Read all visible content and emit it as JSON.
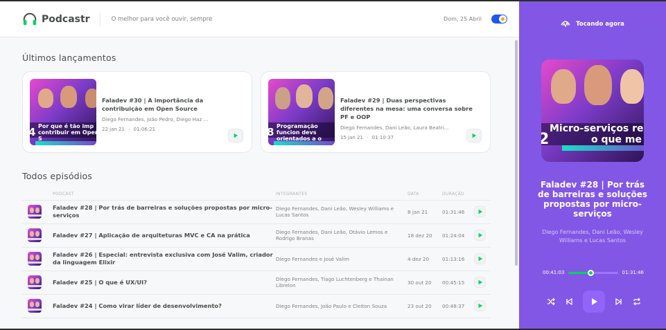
{
  "header": {
    "app_name": "Podcastr",
    "tagline": "O melhor para você ouvir, sempre",
    "date": "Dom, 25 Abril"
  },
  "latest": {
    "title": "Últimos lançamentos",
    "episodes": [
      {
        "title": "Faladev #30 | A importância da contribuição em Open Source",
        "members": "Diego Fernandes, João Pedro, Diego Haz ...",
        "date": "22 jan 21",
        "duration": "01:06:21",
        "thumb_text": "Por que é tão imp contribuir em Open S",
        "thumb_num": "4"
      },
      {
        "title": "Faladev #29 | Duas perspectivas diferentes na mesa: uma conversa sobre PF e OOP",
        "members": "Diego Fernandes, Dani Leão, Laura Beatri...",
        "date": "15 jan 21",
        "duration": "01:10:37",
        "thumb_text": "Programação funcion devs orientados a o",
        "thumb_num": "8"
      }
    ]
  },
  "all": {
    "title": "Todos episódios",
    "columns": [
      "PODCAST",
      "INTEGRANTES",
      "DATA",
      "DURAÇÃO"
    ],
    "rows": [
      {
        "title": "Faladev #28 | Por trás de barreiras e soluções propostas por micro-serviços",
        "members": "Diego Fernandes, Dani Leão, Wesley Williams e Lucas Santos",
        "date": "8 jan 21",
        "duration": "01:31:46"
      },
      {
        "title": "Faladev #27 | Aplicação de arquiteturas MVC e CA na prática",
        "members": "Diego Fernandes, Dani Leão, Otávio Lemos e Rodrigo Branas",
        "date": "18 dez 20",
        "duration": "01:24:04"
      },
      {
        "title": "Faladev #26 | Especial: entrevista exclusiva com José Valim, criador da linguagem Elixir",
        "members": "Diego Fernandes e José Valim",
        "date": "4 dez 20",
        "duration": "01:13:16"
      },
      {
        "title": "Faladev #25 | O que é UX/UI?",
        "members": "Diego Fernandes, Tiago Luchtenberg e Thainan Librelon",
        "date": "30 out 20",
        "duration": "00:45:15"
      },
      {
        "title": "Faladev #24 | Como virar líder de desenvolvimento?",
        "members": "Diego Fernandes, João Paulo e Cleiton Souza",
        "date": "23 out 20",
        "duration": "00:48:37"
      }
    ]
  },
  "player": {
    "heading": "Tocando agora",
    "cover_text_1": "Micro-serviços re",
    "cover_text_2": "o que me",
    "cover_num": "2",
    "title": "Faladev #28 | Por trás de barreiras e soluções propostas por micro-serviços",
    "members": "Diego Fernandes, Dani Leão, Wesley Williams e Lucas Santos",
    "current_time": "00:41:03",
    "total_time": "01:31:46",
    "progress_fraction": 0.45
  },
  "colors": {
    "accent_purple": "#8257e5",
    "green": "#04d361",
    "toggle_blue": "#1f57ed"
  }
}
